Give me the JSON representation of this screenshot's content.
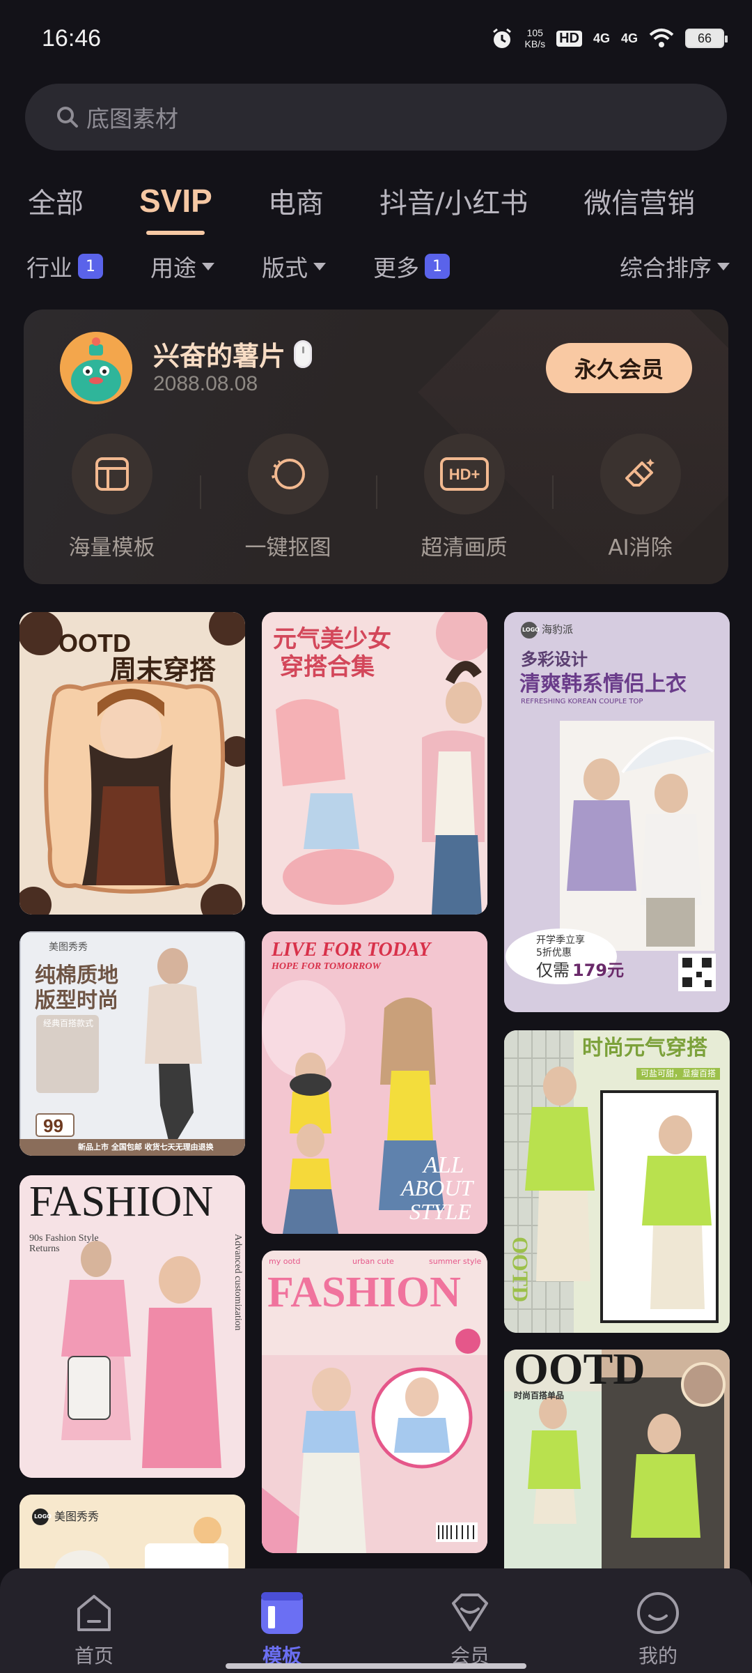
{
  "status_bar": {
    "time": "16:46",
    "net_speed_value": "105",
    "net_speed_unit": "KB/s",
    "hd_label": "HD",
    "signal_1": "4G",
    "signal_2": "4G",
    "battery": "66"
  },
  "search": {
    "placeholder": "底图素材"
  },
  "tabs": [
    {
      "label": "全部",
      "active": false
    },
    {
      "label": "SVIP",
      "active": true
    },
    {
      "label": "电商",
      "active": false
    },
    {
      "label": "抖音/小红书",
      "active": false
    },
    {
      "label": "微信营销",
      "active": false
    }
  ],
  "filters": {
    "industry": {
      "label": "行业",
      "badge": "1"
    },
    "usage": {
      "label": "用途"
    },
    "layout": {
      "label": "版式"
    },
    "more": {
      "label": "更多",
      "badge": "1"
    },
    "sort": {
      "label": "综合排序"
    }
  },
  "member": {
    "username": "兴奋的薯片",
    "date": "2088.08.08",
    "button": "永久会员",
    "benefits": [
      {
        "label": "海量模板",
        "icon": "template-icon"
      },
      {
        "label": "一键抠图",
        "icon": "cutout-icon"
      },
      {
        "label": "超清画质",
        "icon": "hd-plus-icon"
      },
      {
        "label": "AI消除",
        "icon": "eraser-icon"
      }
    ]
  },
  "templates": [
    {
      "title": "OOTD",
      "subtitle": "周末穿搭"
    },
    {
      "title": "元气美少女",
      "subtitle": "穿搭合集"
    },
    {
      "brand": "海豹派",
      "logo": "LOGO",
      "title": "多彩设计",
      "subtitle": "清爽韩系情侣上衣",
      "en": "REFRESHING KOREAN COUPLE TOP",
      "promo": "开学季立享",
      "promo2": "5折优惠",
      "price_prefix": "仅需",
      "price": "179元"
    },
    {
      "brand": "美图秀秀",
      "title": "纯棉质地",
      "subtitle": "版型时尚",
      "tag": "经典百搭款式",
      "price": "99",
      "footer": "新品上市 全国包邮 收货七天无理由退换"
    },
    {
      "title": "LIVE FOR TODAY",
      "subtitle": "HOPE FOR TOMORROW",
      "slogan_1": "ALL",
      "slogan_2": "ABOUT",
      "slogan_3": "STYLE"
    },
    {
      "title": "时尚元气穿搭",
      "tag": "可盐可甜，显瘦百搭",
      "side": "OOTD"
    },
    {
      "title": "FASHION",
      "subtitle": "90s Fashion Style Returns",
      "side": "Advanced customization"
    },
    {
      "title": "FASHION",
      "top_1": "my ootd",
      "top_2": "urban cute",
      "top_3": "summer style"
    },
    {
      "brand": "美图秀秀",
      "logo": "LOGO"
    },
    {
      "title": "OOTD",
      "tag": "时尚百搭单品"
    }
  ],
  "bottom_nav": [
    {
      "label": "首页",
      "icon": "home-icon",
      "active": false
    },
    {
      "label": "模板",
      "icon": "template-tab-icon",
      "active": true
    },
    {
      "label": "会员",
      "icon": "diamond-icon",
      "active": false
    },
    {
      "label": "我的",
      "icon": "profile-icon",
      "active": false
    }
  ]
}
